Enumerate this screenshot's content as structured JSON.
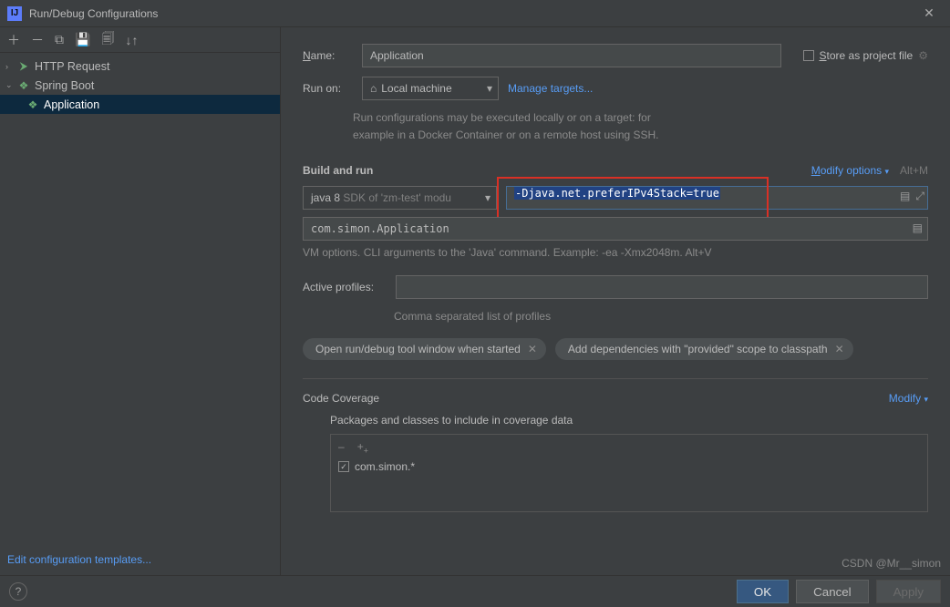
{
  "window": {
    "title": "Run/Debug Configurations"
  },
  "toolbar": {
    "add": "＋",
    "remove": "－",
    "copy": "⧉",
    "save": "💾",
    "folder": "🗐",
    "sort": "↓↑"
  },
  "tree": {
    "http": {
      "icon": "⮞",
      "label": "HTTP Request"
    },
    "spring": {
      "icon": "⌄",
      "leaf_icon": "❖",
      "label": "Spring Boot"
    },
    "app": {
      "icon": "❖",
      "label": "Application"
    }
  },
  "link_templates": "Edit configuration templates...",
  "form": {
    "name_label_html": "<u>N</u>ame:",
    "name_value": "Application",
    "store_label": "<u>S</u>tore as project file",
    "runon_label": "Run on:",
    "runon_value": "Local machine",
    "home_glyph": "⌂",
    "manage_targets": "Manage targets...",
    "runon_hint1": "Run configurations may be executed locally or on a target: for",
    "runon_hint2": "example in a Docker Container or on a remote host using SSH."
  },
  "build": {
    "title": "Build and run",
    "modify": "Modify options",
    "shortcut": "Alt+M",
    "sdk_prefix": "java 8 ",
    "sdk_suffix": "SDK of 'zm-test' modu",
    "vm_value": "-Djava.net.preferIPv4Stack=true",
    "main_class": "com.simon.Application",
    "vm_hint": "VM options. CLI arguments to the 'Java' command. Example: -ea -Xmx2048m. Alt+V",
    "profiles_label": "Active profiles:",
    "profiles_hint": "Comma separated list of profiles",
    "chip1": "Open run/debug tool window when started",
    "chip2": "Add dependencies with \"provided\" scope to classpath"
  },
  "coverage": {
    "title": "Code Coverage",
    "modify": "Modify",
    "packages_label": "Packages and classes to include in coverage data",
    "entry": "com.simon.*"
  },
  "buttons": {
    "ok": "OK",
    "cancel": "Cancel",
    "apply": "Apply"
  },
  "watermark": "CSDN @Mr__simon"
}
